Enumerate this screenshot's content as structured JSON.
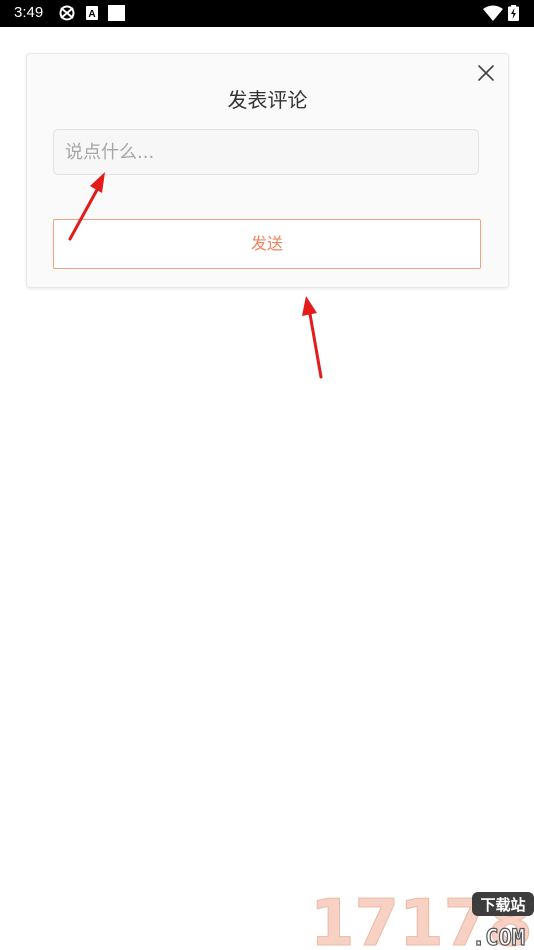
{
  "status_bar": {
    "time": "3:49",
    "icons": [
      "sync-icon",
      "a-notification-icon",
      "square-notification-icon",
      "wifi-icon",
      "battery-charging-icon"
    ]
  },
  "dialog": {
    "title": "发表评论",
    "close_icon": "close-icon",
    "input": {
      "value": "",
      "placeholder": "说点什么..."
    },
    "send_label": "发送"
  },
  "watermark": {
    "text": "17178下载站.COM"
  },
  "colors": {
    "accent": "#f1825e",
    "annotation_arrow": "#e31b1b"
  }
}
